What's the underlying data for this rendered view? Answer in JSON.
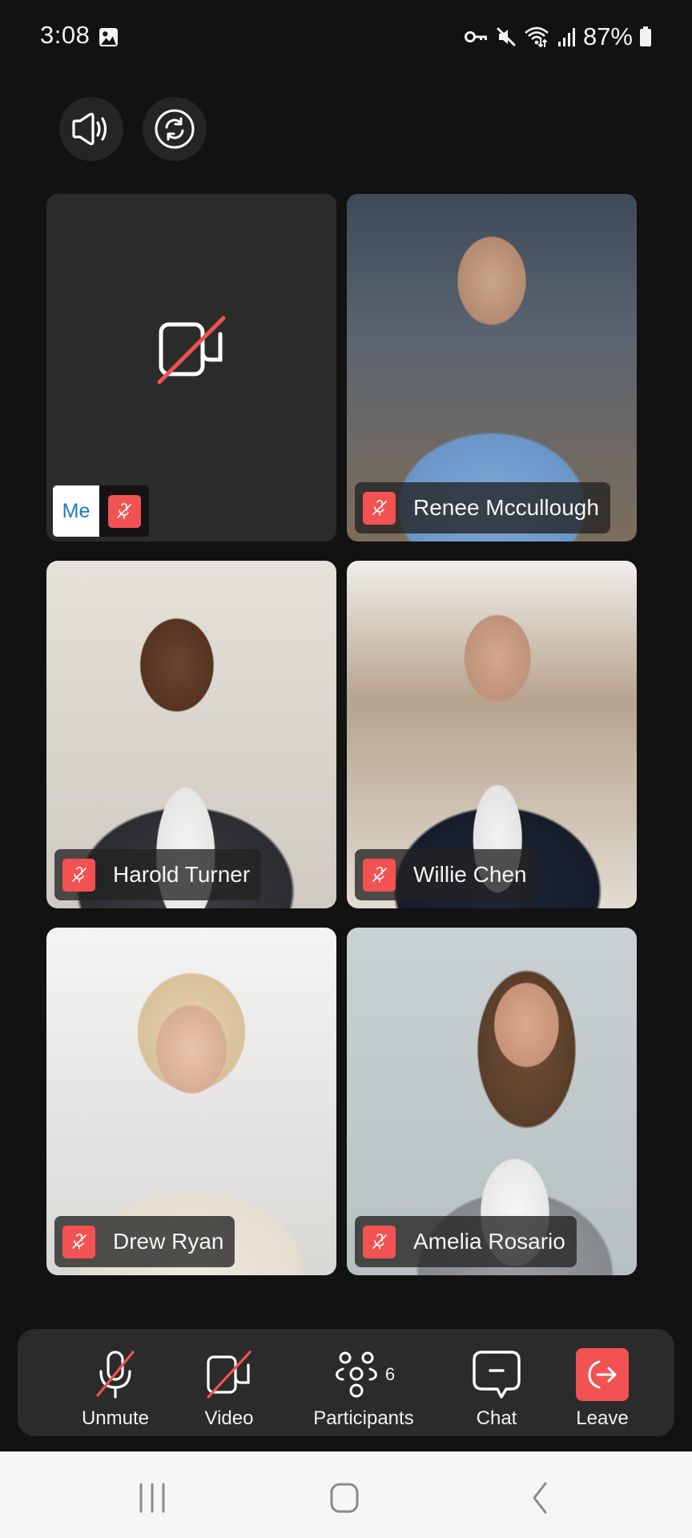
{
  "status_bar": {
    "time": "3:08",
    "battery_percent": "87%",
    "icons": [
      "gallery-icon",
      "vpn-key-icon",
      "mute-icon",
      "wifi-icon",
      "signal-icon",
      "battery-icon"
    ]
  },
  "top_controls": {
    "speaker": {
      "icon": "speaker-icon"
    },
    "switch_camera": {
      "icon": "switch-camera-icon"
    }
  },
  "tiles": [
    {
      "name": "Me",
      "video_on": false,
      "muted": true,
      "is_self": true
    },
    {
      "name": "Renee Mccullough",
      "video_on": true,
      "muted": true
    },
    {
      "name": "Harold Turner",
      "video_on": true,
      "muted": true
    },
    {
      "name": "Willie Chen",
      "video_on": true,
      "muted": true
    },
    {
      "name": "Drew Ryan",
      "video_on": true,
      "muted": true
    },
    {
      "name": "Amelia Rosario",
      "video_on": true,
      "muted": true
    }
  ],
  "toolbar": {
    "unmute": "Unmute",
    "video": "Video",
    "participants": "Participants",
    "participants_count": "6",
    "chat": "Chat",
    "leave": "Leave"
  },
  "colors": {
    "background": "#121212",
    "tile": "#2b2b2b",
    "danger": "#f25252",
    "me_text": "#1f78c8"
  },
  "nav_bar": {
    "recents": "recents-icon",
    "home": "home-icon",
    "back": "back-icon"
  }
}
